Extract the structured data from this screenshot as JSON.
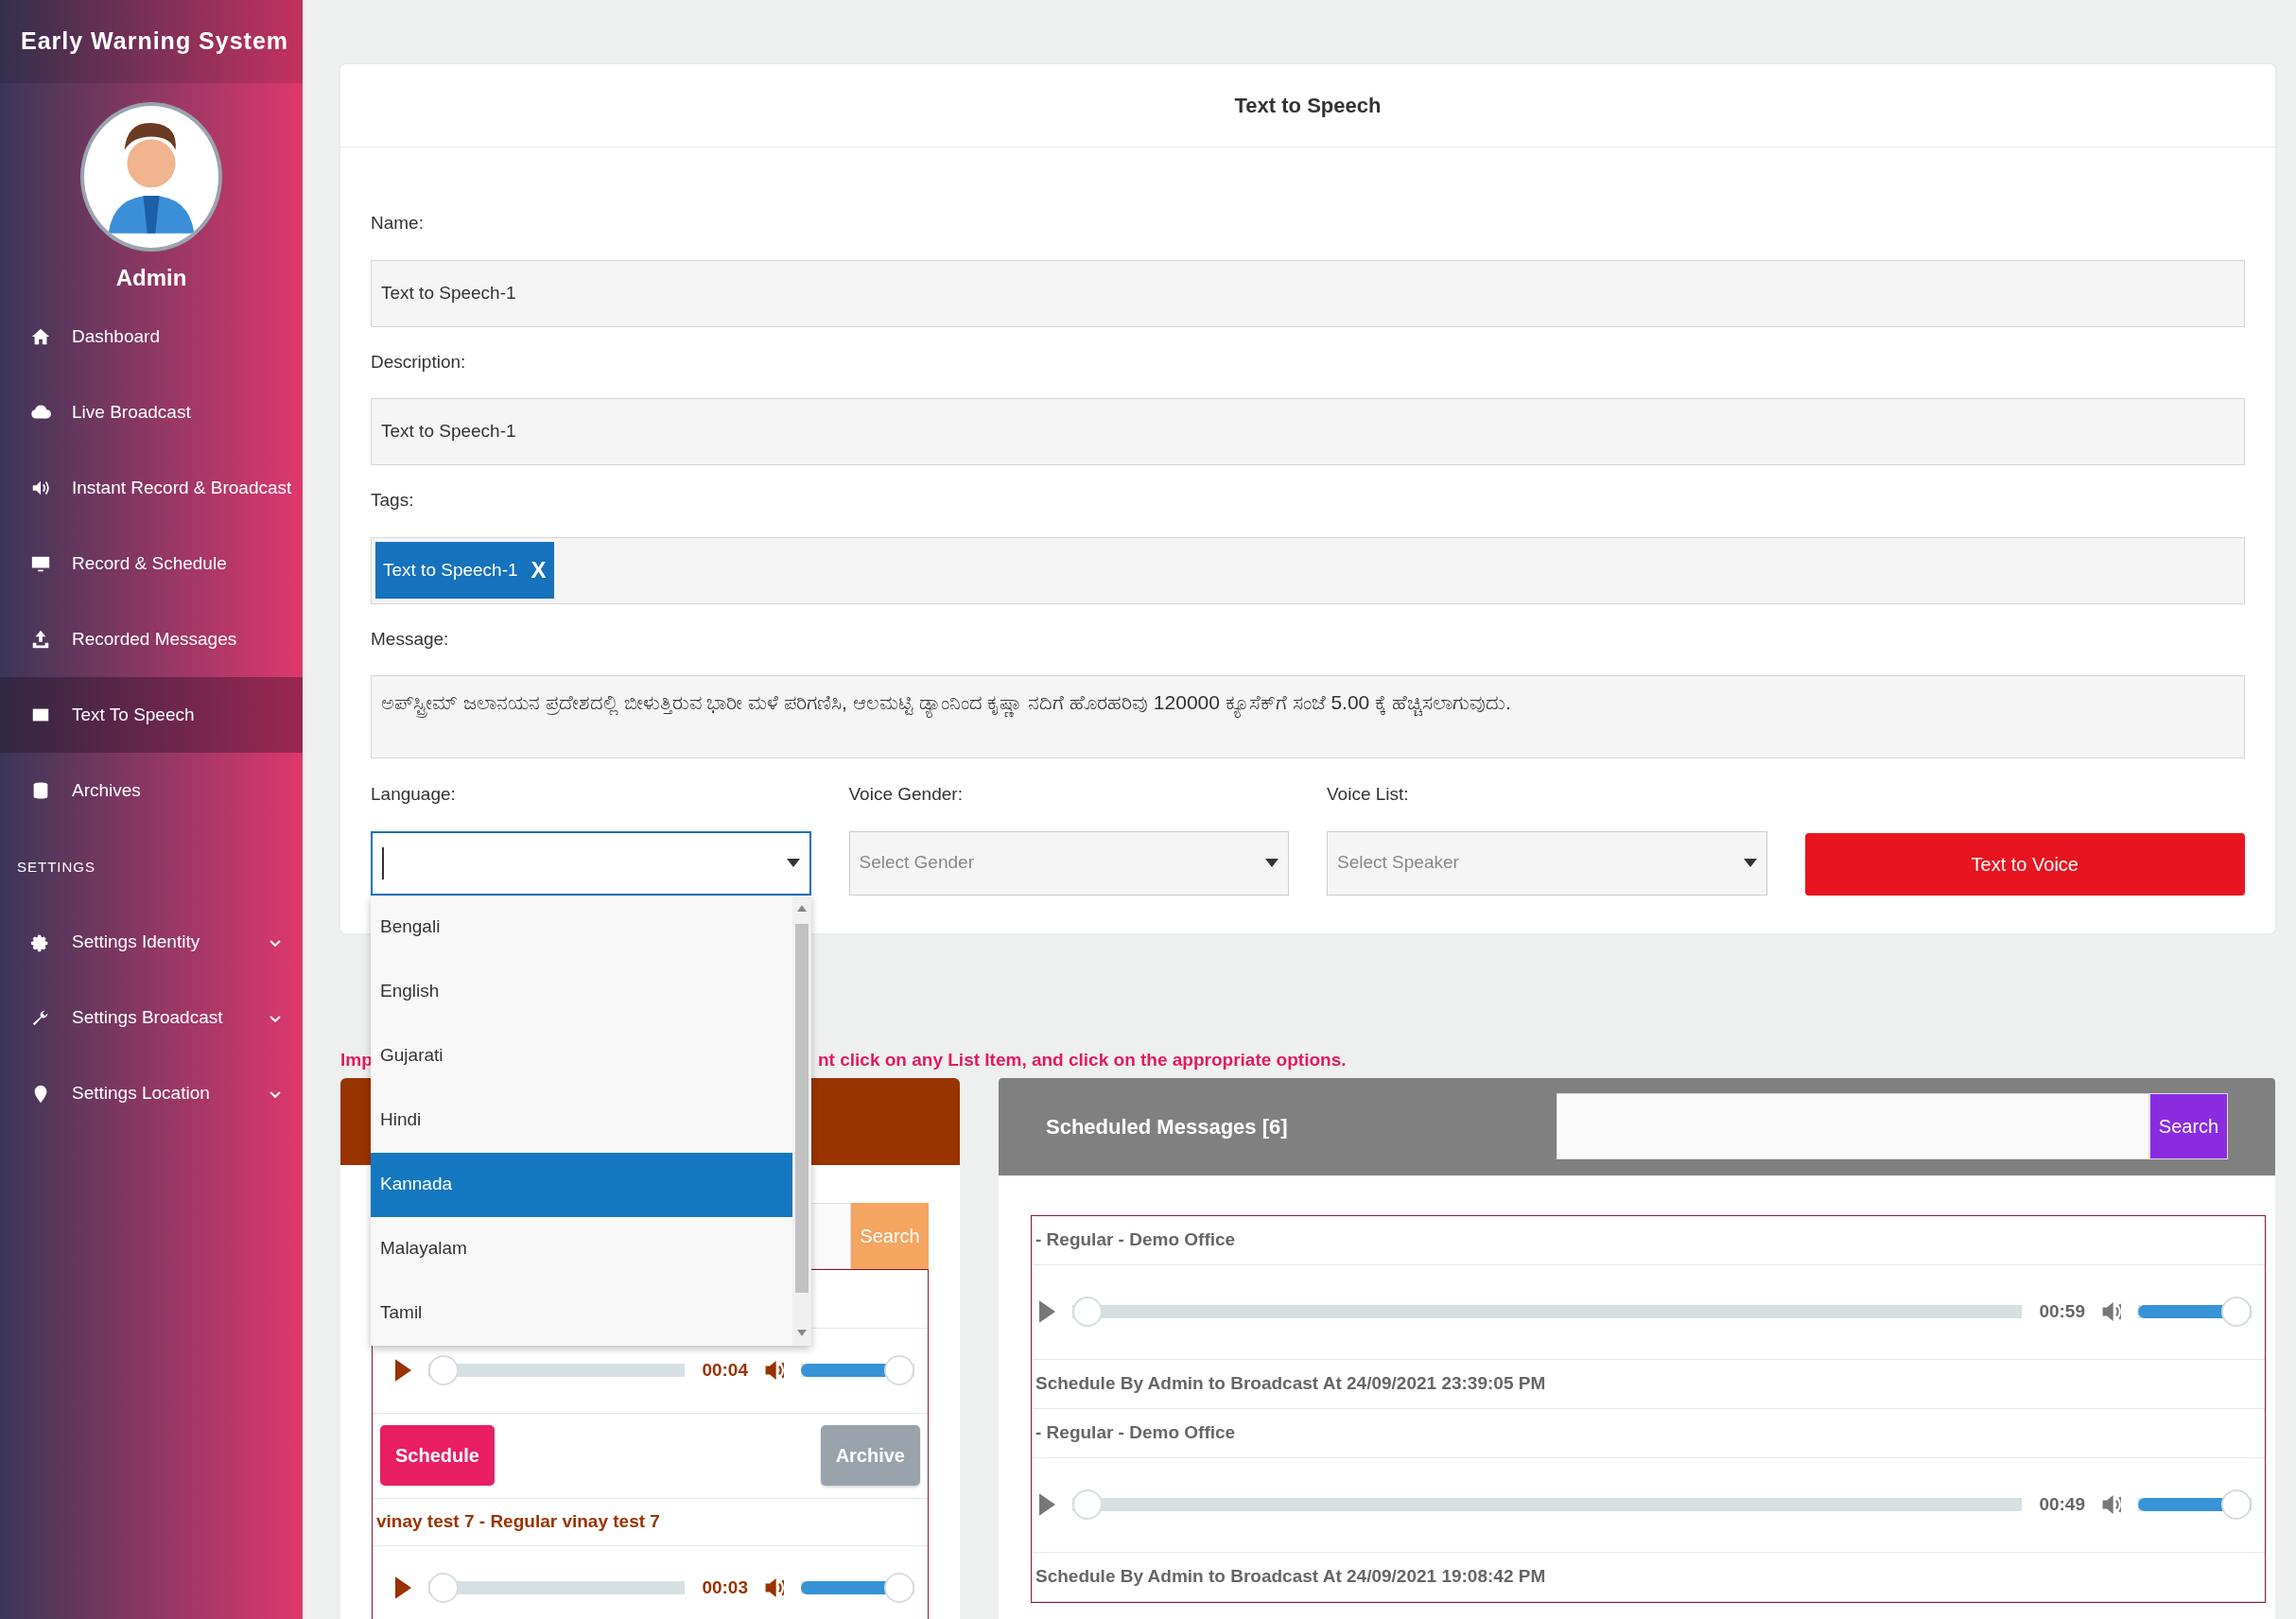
{
  "sidebar": {
    "brand": "Early Warning System",
    "user": "Admin",
    "items": [
      {
        "label": "Dashboard",
        "kind": "home",
        "selected": false
      },
      {
        "label": "Live Broadcast",
        "kind": "cloud",
        "selected": false
      },
      {
        "label": "Instant Record & Broadcast",
        "kind": "speaker",
        "selected": false
      },
      {
        "label": "Record & Schedule",
        "kind": "monitor",
        "selected": false
      },
      {
        "label": "Recorded Messages",
        "kind": "upload",
        "selected": false
      },
      {
        "label": "Text To Speech",
        "kind": "ad",
        "selected": true
      },
      {
        "label": "Archives",
        "kind": "database",
        "selected": false
      }
    ],
    "section": "SETTINGS",
    "settings_items": [
      {
        "label": "Settings Identity",
        "kind": "gears",
        "expanded": false
      },
      {
        "label": "Settings Broadcast",
        "kind": "wrench",
        "expanded": false
      },
      {
        "label": "Settings Location",
        "kind": "pin",
        "expanded": false
      }
    ]
  },
  "form": {
    "title": "Text to Speech",
    "fields": [
      {
        "label": "Name:",
        "value": "Text to Speech-1"
      },
      {
        "label": "Description:",
        "value": "Text to Speech-1"
      }
    ],
    "tags": {
      "label": "Tags:",
      "items": [
        {
          "text": "Text to Speech-1",
          "remove": "X"
        }
      ]
    },
    "message": {
      "label": "Message:",
      "value": "ಅಪ್‌ಸ್ಟ್ರೀಮ್ ಜಲಾನಯನ ಪ್ರದೇಶದಲ್ಲಿ ಬೀಳುತ್ತಿರುವ ಭಾರೀ ಮಳೆ ಪರಿಗಣಿಸಿ, ಆಲಮಟ್ಟಿ ಡ್ಯಾಂನಿಂದ ಕೃಷ್ಣಾ ನದಿಗೆ ಹೊರಹರಿವು 120000 ಕ್ಯೂಸೆಕ್‌ಗೆ ಸಂಜೆ 5.00 ಕ್ಕೆ ಹೆಚ್ಚಿಸಲಾಗುವುದು."
    },
    "selects": [
      {
        "label": "Language:",
        "focused": true,
        "open": true,
        "options": [
          {
            "label": "Bengali",
            "selected": false
          },
          {
            "label": "English",
            "selected": false
          },
          {
            "label": "Gujarati",
            "selected": false
          },
          {
            "label": "Hindi",
            "selected": false
          },
          {
            "label": "Kannada",
            "selected": true
          },
          {
            "label": "Malayalam",
            "selected": false
          },
          {
            "label": "Tamil",
            "selected": false
          }
        ]
      },
      {
        "label": "Voice Gender:",
        "placeholder": "Select Gender",
        "focused": false
      },
      {
        "label": "Voice List:",
        "placeholder": "Select Speaker",
        "focused": false
      }
    ],
    "button": "Text to Voice"
  },
  "notice": [
    "Imp",
    "nt click on any List Item, and click on the appropriate options."
  ],
  "left_panel": {
    "search_button": "Search",
    "items": [
      {
        "player": {
          "time": "00:04",
          "position": {
            "level": 0
          },
          "volume": {
            "level": 1
          }
        },
        "buttons": [
          {
            "label": "Schedule",
            "disabled": false
          },
          {
            "label": "Archive",
            "disabled": true
          }
        ]
      },
      {
        "title": "vinay test 7 - Regular vinay test 7",
        "player": {
          "time": "00:03",
          "position": {
            "level": 0
          },
          "volume": {
            "level": 1
          }
        }
      }
    ]
  },
  "right_panel": {
    "title": "Scheduled Messages [6]",
    "search_button": "Search",
    "items": [
      {
        "title": "- Regular - Demo Office",
        "player": {
          "time": "00:59",
          "position": {
            "level": 0
          },
          "volume": {
            "level": 1
          }
        },
        "info": "Schedule By Admin to Broadcast At 24/09/2021 23:39:05 PM"
      },
      {
        "title": "- Regular - Demo Office",
        "player": {
          "time": "00:49",
          "position": {
            "level": 0
          },
          "volume": {
            "level": 1
          }
        },
        "info": "Schedule By Admin to Broadcast At 24/09/2021 19:08:42 PM"
      }
    ]
  }
}
